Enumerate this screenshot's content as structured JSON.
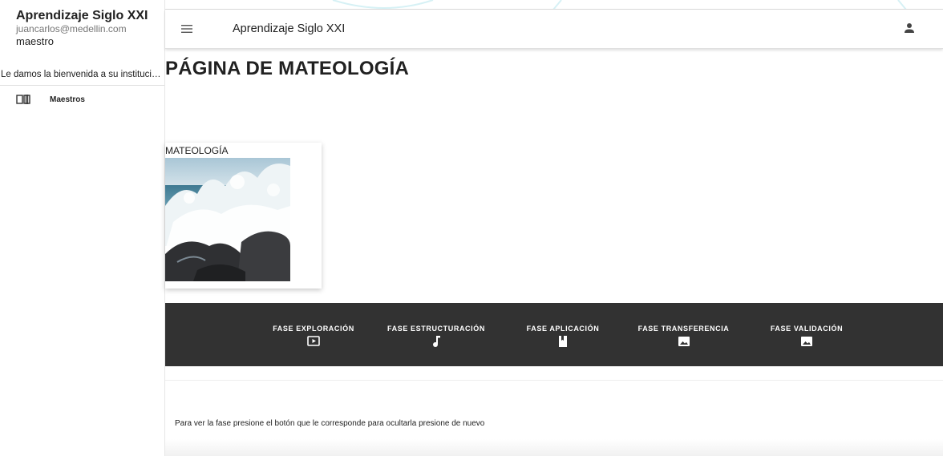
{
  "sidebar": {
    "app_name": "Aprendizaje Siglo XXI",
    "email": "juancarlos@medellin.com",
    "role": "maestro",
    "welcome": "Le damos la bienvenida a su institución educativa",
    "items": [
      {
        "label": "Maestros",
        "icon": "book-icon"
      }
    ]
  },
  "appbar": {
    "title": "Aprendizaje Siglo XXI",
    "menu_icon": "menu-icon",
    "user_icon": "person-icon"
  },
  "main": {
    "page_title": "PÁGINA DE MATEOLOGÍA",
    "card": {
      "title": "MATEOLOGÍA",
      "image": "wave-image"
    },
    "phases": [
      {
        "label": "FASE EXPLORACIÓN",
        "icon": "play-video-icon"
      },
      {
        "label": "FASE ESTRUCTURACIÓN",
        "icon": "music-note-icon"
      },
      {
        "label": "FASE APLICACIÓN",
        "icon": "book-icon"
      },
      {
        "label": "FASE TRANSFERENCIA",
        "icon": "image-icon"
      },
      {
        "label": "FASE VALIDACIÓN",
        "icon": "image-icon"
      }
    ],
    "hint": "Para ver la fase presione el botón que le corresponde para ocultarla presione de nuevo"
  },
  "colors": {
    "phase_bar_bg": "#323232",
    "text": "#212121"
  }
}
